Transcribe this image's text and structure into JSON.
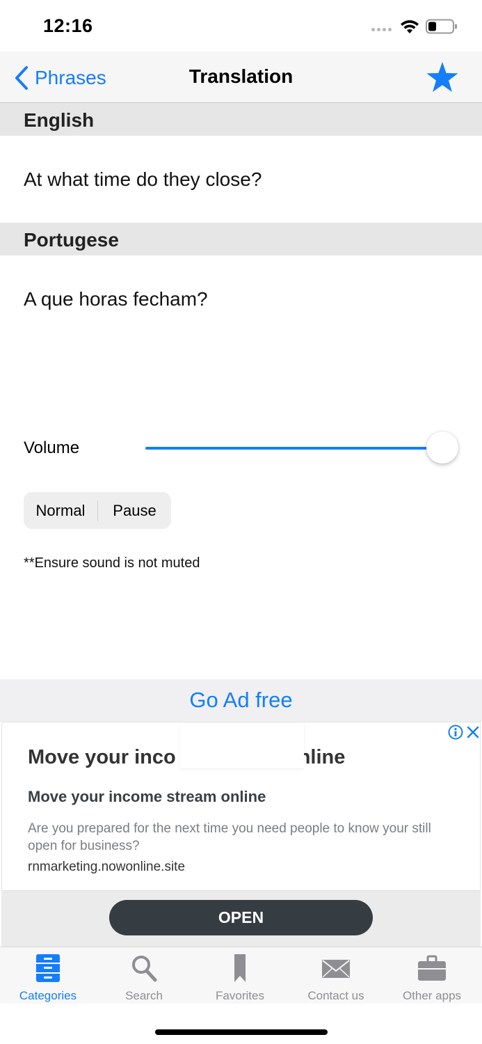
{
  "status_bar": {
    "time": "12:16"
  },
  "nav": {
    "back_label": "Phrases",
    "title": "Translation"
  },
  "english": {
    "header": "English",
    "text": "At what time do they close?"
  },
  "portuguese": {
    "header": "Portugese",
    "text": "A que horas fecham?"
  },
  "volume": {
    "label": "Volume",
    "value_fraction": 1.0
  },
  "playback": {
    "normal_label": "Normal",
    "pause_label": "Pause"
  },
  "note": "**Ensure sound is not muted",
  "ad_free": "Go Ad free",
  "ad": {
    "headline_left": "Move your inco",
    "headline_right": "nline",
    "subhead": "Move your income stream online",
    "body": "Are you prepared for the next time you need people to know your still open for business?",
    "domain": "rnmarketing.nowonline.site",
    "button": "OPEN"
  },
  "tabs": [
    {
      "label": "Categories",
      "icon": "categories-icon",
      "active": true
    },
    {
      "label": "Search",
      "icon": "search-icon",
      "active": false
    },
    {
      "label": "Favorites",
      "icon": "bookmark-icon",
      "active": false
    },
    {
      "label": "Contact us",
      "icon": "mail-icon",
      "active": false
    },
    {
      "label": "Other apps",
      "icon": "briefcase-icon",
      "active": false
    }
  ],
  "colors": {
    "accent": "#147efb",
    "section_bg": "#e6e6e6",
    "ad_button": "#353c42"
  }
}
